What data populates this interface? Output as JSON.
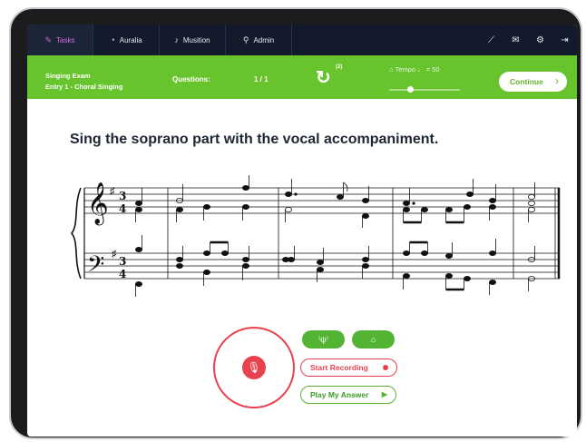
{
  "nav": {
    "tabs": [
      {
        "label": "Tasks",
        "icon": "edit-icon",
        "active": true
      },
      {
        "label": "Auralia",
        "icon": "auralia-icon",
        "active": false
      },
      {
        "label": "Musition",
        "icon": "musition-icon",
        "active": false
      },
      {
        "label": "Admin",
        "icon": "admin-icon",
        "active": false
      }
    ],
    "right_icons": [
      "chart-icon",
      "mail-icon",
      "gear-icon",
      "logout-icon"
    ]
  },
  "exam": {
    "title": "Singing Exam",
    "subtitle": "Entry 1 - Choral Singing",
    "questions_label": "Questions:",
    "questions_value": "1 / 1",
    "retry_count": "(2)",
    "tempo_label": "Tempo",
    "tempo_value": "= 50",
    "tempo_slider_fraction": 0.3,
    "continue_label": "Continue"
  },
  "instruction": "Sing the soprano part with the vocal accompaniment.",
  "controls": {
    "start_recording": "Start Recording",
    "play_answer": "Play My Answer"
  },
  "colors": {
    "nav_bg": "#121a2b",
    "green": "#68c42c",
    "red": "#e8424f"
  }
}
